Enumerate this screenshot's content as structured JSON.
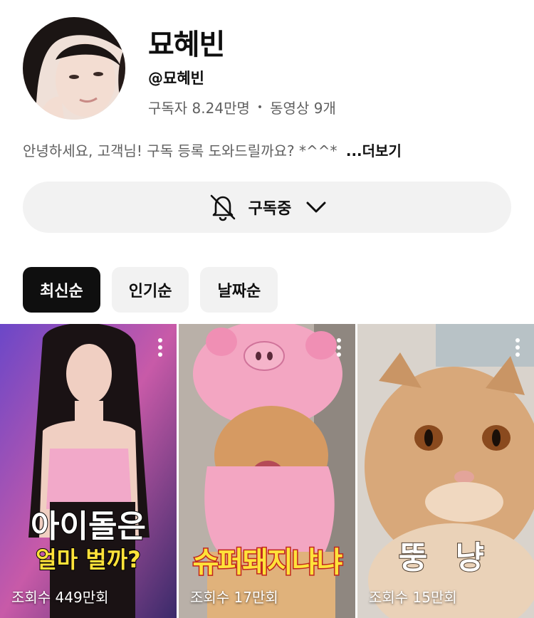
{
  "channel": {
    "name": "묘혜빈",
    "handle": "@묘혜빈",
    "subscribers": "구독자 8.24만명",
    "separator": "•",
    "videos": "동영상 9개",
    "description": "안녕하세요, 고객님! 구독 등록 도와드릴까요? *^^*",
    "more_label": "...더보기"
  },
  "subscribe": {
    "label": "구독중",
    "icon": "bell-off-icon",
    "chevron": "chevron-down-icon"
  },
  "chips": [
    "최신순",
    "인기순",
    "날짜순"
  ],
  "videos": [
    {
      "overlay_line1": "아이돌은",
      "overlay_line2": "얼마 벌까?",
      "views": "조회수 449만회"
    },
    {
      "overlay_line1": "슈퍼돼지냐냐",
      "views": "조회수 17만회"
    },
    {
      "overlay_line1": "뚱 냥",
      "views": "조회수 15만회"
    }
  ],
  "colors": {
    "chip_active_bg": "#0f0f0f",
    "chip_bg": "#f2f2f2",
    "secondary_text": "#606060"
  }
}
